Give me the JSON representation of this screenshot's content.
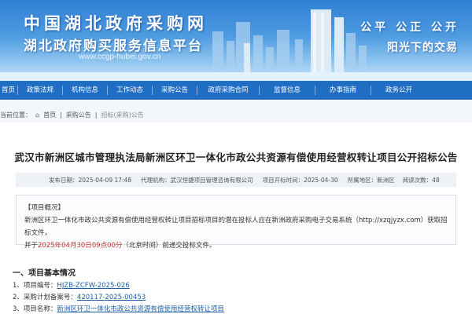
{
  "header": {
    "title": "中国湖北政府采购网",
    "subtitle": "湖北政府购买服务信息平台",
    "url": "www.ccgp-hubei.gov.cn",
    "slogan_line1": "公平 公正 公开",
    "slogan_line2": "阳光下的交易"
  },
  "nav": {
    "items": [
      "首页",
      "政策法规",
      "机构信息",
      "工作动态",
      "采购公告",
      "政府采购合同",
      "监督信息",
      "办事指南",
      "政务公开"
    ]
  },
  "breadcrumb": {
    "label": "当前位置：",
    "home": "首页",
    "section": "采购公告",
    "current": "招标(采购)公告"
  },
  "notice": {
    "title": "武汉市新洲区城市管理执法局新洲区环卫一体化市政公共资源有偿使用经营权转让项目公开招标公告",
    "meta": {
      "published": "发布日期：2025-04-09 17:48",
      "agency": "代理机构：武汉恒捷项目管理咨询有限公司",
      "open_date": "项目开标时间：2025-04-30",
      "region": "所属地区：新洲区",
      "views": "阅读次数：48"
    },
    "overview": {
      "heading": "【项目概况】",
      "line1": "新洲区环卫一体化市政公共资源有偿使用经营权转让项目招标项目的潜在投标人应在新洲政府采购电子交易系统（http://xzqjyzx.com）获取招标文件，",
      "line2_prefix": "并于",
      "line2_time": "2025年04月30日09点00分",
      "line2_suffix": "（北京时间）前递交投标文件。"
    },
    "section1_title": "一、项目基本情况",
    "info": [
      {
        "label": "1、项目编号：",
        "value": "HJZB-ZCFW-2025-026"
      },
      {
        "label": "2、采购计划备案号：",
        "value": "420117-2025-00453"
      },
      {
        "label": "3、项目名称：",
        "value": "新洲区环卫一体化市政公共资源有偿使用经营权转让项目"
      }
    ]
  }
}
